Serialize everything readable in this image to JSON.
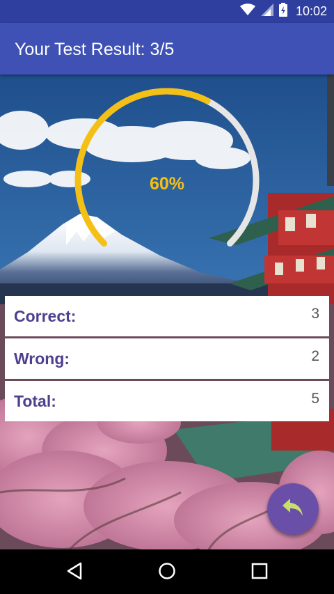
{
  "status_bar": {
    "time": "10:02",
    "icons": [
      "wifi-icon",
      "signal-icon",
      "battery-icon"
    ]
  },
  "app_bar": {
    "title": "Your Test Result: 3/5"
  },
  "progress": {
    "percent_label": "60%",
    "fraction": 0.6,
    "arc_color": "#f5c016",
    "track_color": "#e6e6e6"
  },
  "results": [
    {
      "label": "Correct:",
      "value": "3"
    },
    {
      "label": "Wrong:",
      "value": "2"
    },
    {
      "label": "Total:",
      "value": "5"
    }
  ],
  "fab": {
    "icon": "reply-icon",
    "color": "#6a4fa8",
    "icon_color": "#c8e06a"
  },
  "nav_bar": {
    "buttons": [
      "back-icon",
      "home-icon",
      "recents-icon"
    ]
  },
  "colors": {
    "status_bar": "#2f3f9f",
    "app_bar": "#3f51b5",
    "label_text": "#4f3f8f"
  }
}
